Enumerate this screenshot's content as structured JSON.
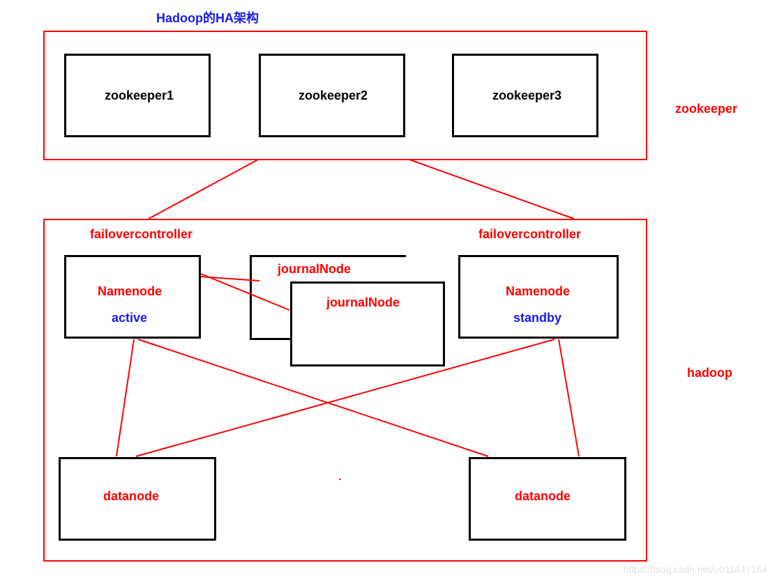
{
  "title": "Hadoop的HA架构",
  "clusters": {
    "zookeeper": {
      "label": "zookeeper",
      "nodes": [
        "zookeeper1",
        "zookeeper2",
        "zookeeper3"
      ]
    },
    "hadoop": {
      "label": "hadoop",
      "failover_label_left": "failovercontroller",
      "failover_label_right": "failovercontroller",
      "namenodes": [
        {
          "name": "Namenode",
          "state": "active"
        },
        {
          "name": "Namenode",
          "state": "standby"
        }
      ],
      "journal_nodes": [
        "journalNode",
        "journalNode"
      ],
      "datanodes": [
        "datanode",
        "datanode"
      ]
    }
  },
  "dot_marker": "·",
  "watermark": "https://blog.csdn.net/u011447164"
}
